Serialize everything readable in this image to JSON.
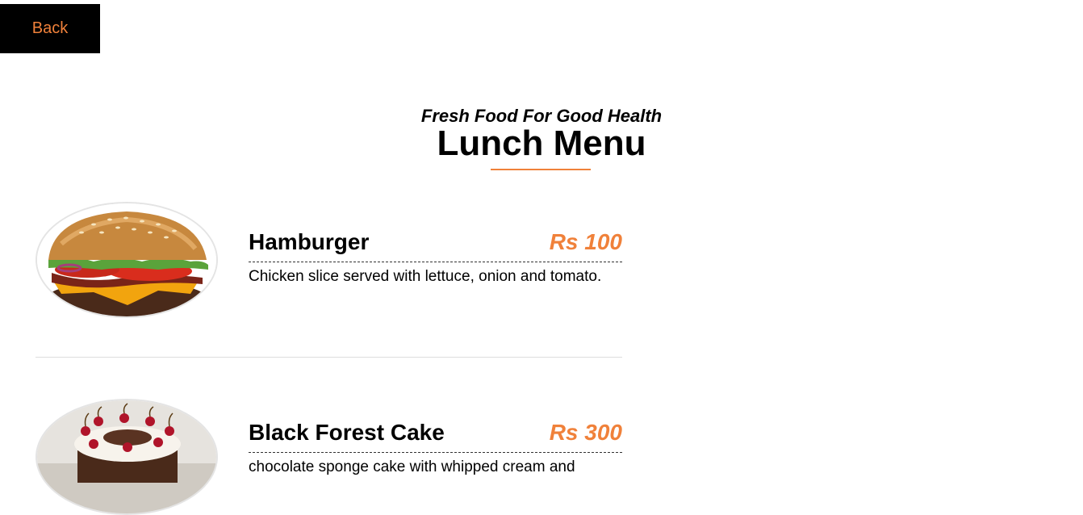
{
  "nav": {
    "back_label": "Back"
  },
  "header": {
    "subtitle": "Fresh Food For Good Health",
    "title": "Lunch Menu"
  },
  "colors": {
    "accent": "#f0813a",
    "back_bg": "#000000"
  },
  "menu": {
    "items": [
      {
        "name": "Hamburger",
        "price": "Rs 100",
        "description": "Chicken slice served with lettuce, onion and tomato.",
        "image": "hamburger-image"
      },
      {
        "name": "Black Forest Cake",
        "price": "Rs 300",
        "description": "chocolate sponge cake with whipped cream and",
        "image": "black-forest-cake-image"
      }
    ]
  }
}
